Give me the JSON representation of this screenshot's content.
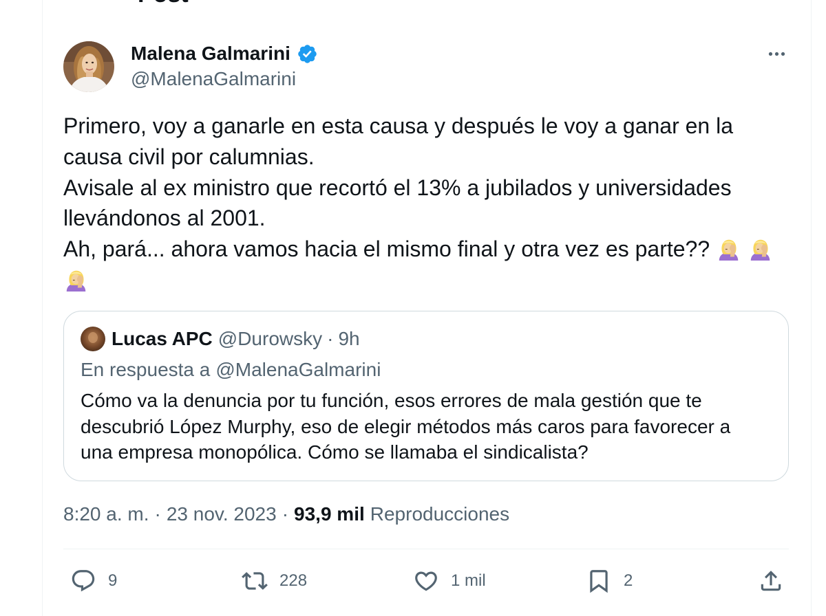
{
  "header": {
    "title": "Post",
    "back_icon": "back-arrow-icon"
  },
  "post": {
    "author": {
      "name": "Malena Galmarini",
      "handle": "@MalenaGalmarini",
      "verified": true,
      "verified_icon": "verified-badge-icon"
    },
    "more_icon": "more-horizontal-icon",
    "text_lines": [
      "Primero, voy a ganarle en esta causa y después le voy a ganar en la",
      "causa civil por calumnias.",
      "Avisale al ex ministro que recortó el 13% a jubilados y universidades",
      "llevándonos al 2001.",
      "Ah, pará... ahora vamos hacia el mismo final y otra vez es parte??"
    ],
    "emoji_icon": "woman-facepalming-emoji",
    "quote": {
      "author": {
        "name": "Lucas APC",
        "handle": "@Durowsky"
      },
      "separator": "·",
      "time": "9h",
      "reply_prefix": "En respuesta a",
      "reply_to": "@MalenaGalmarini",
      "text_lines": [
        "Cómo va la denuncia por tu función, esos errores de mala gestión que te",
        "descubrió López Murphy, eso de elegir métodos más caros para favorecer a",
        "una empresa monopólica. Cómo se llamaba el sindicalista?"
      ]
    },
    "timestamp": {
      "time": "8:20 a. m.",
      "separator": "·",
      "date": "23 nov. 2023",
      "views_count": "93,9 mil",
      "views_label": "Reproducciones"
    },
    "actions": [
      {
        "id": "reply",
        "icon": "reply-icon",
        "count": "9"
      },
      {
        "id": "retweet",
        "icon": "retweet-icon",
        "count": "228"
      },
      {
        "id": "like",
        "icon": "heart-icon",
        "count": "1 mil"
      },
      {
        "id": "bookmark",
        "icon": "bookmark-icon",
        "count": "2"
      },
      {
        "id": "share",
        "icon": "share-icon"
      }
    ]
  },
  "colors": {
    "text": "#0f1419",
    "secondary": "#536471",
    "accent": "#1d9bf0",
    "quote_border": "#cfd9de",
    "divider": "#eff3f4"
  }
}
